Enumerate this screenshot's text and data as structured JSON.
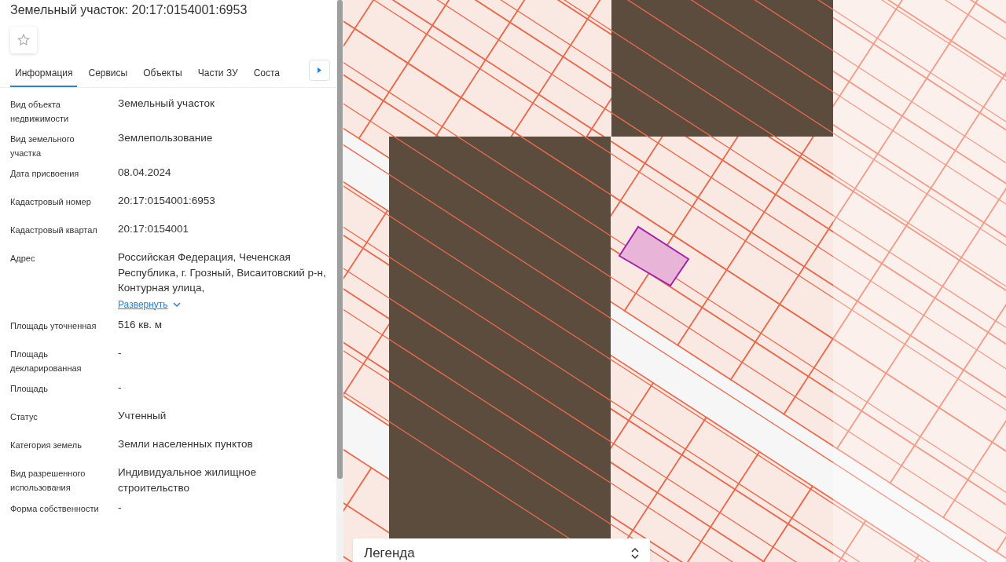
{
  "panel": {
    "title": "Земельный участок: 20:17:0154001:6953",
    "tabs": [
      {
        "label": "Информация",
        "selected": true
      },
      {
        "label": "Сервисы",
        "selected": false
      },
      {
        "label": "Объекты",
        "selected": false
      },
      {
        "label": "Части ЗУ",
        "selected": false
      },
      {
        "label": "Соста",
        "selected": false
      }
    ],
    "fields": [
      {
        "label": "Вид объекта недвижимости",
        "value": "Земельный участок"
      },
      {
        "label": "Вид земельного участка",
        "value": "Землепользование"
      },
      {
        "label": "Дата присвоения",
        "value": "08.04.2024"
      },
      {
        "label": "Кадастровый номер",
        "value": "20:17:0154001:6953"
      },
      {
        "label": "Кадастровый квартал",
        "value": "20:17:0154001"
      },
      {
        "label": "Адрес",
        "value": "Российская Федерация, Чеченская Республика, г. Грозный, Висаитовский р-н, Контурная улица,",
        "expand_link": "Развернуть"
      },
      {
        "label": "Площадь уточненная",
        "value": "516 кв. м"
      },
      {
        "label": "Площадь декларированная",
        "value": "-"
      },
      {
        "label": "Площадь",
        "value": "-"
      },
      {
        "label": "Статус",
        "value": "Учтенный"
      },
      {
        "label": "Категория земель",
        "value": "Земли населенных пунктов"
      },
      {
        "label": "Вид разрешенного использования",
        "value": "Индивидуальное жилищное строительство"
      },
      {
        "label": "Форма собственности",
        "value": "-"
      }
    ]
  },
  "map": {
    "legend": {
      "title": "Легенда"
    }
  }
}
